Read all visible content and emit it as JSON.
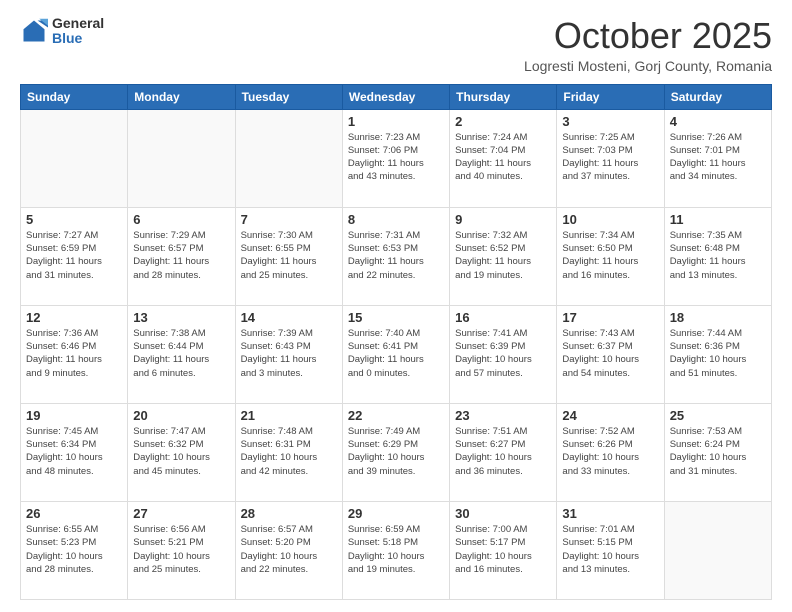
{
  "logo": {
    "general": "General",
    "blue": "Blue"
  },
  "header": {
    "month": "October 2025",
    "location": "Logresti Mosteni, Gorj County, Romania"
  },
  "days_of_week": [
    "Sunday",
    "Monday",
    "Tuesday",
    "Wednesday",
    "Thursday",
    "Friday",
    "Saturday"
  ],
  "weeks": [
    [
      {
        "day": "",
        "info": ""
      },
      {
        "day": "",
        "info": ""
      },
      {
        "day": "",
        "info": ""
      },
      {
        "day": "1",
        "info": "Sunrise: 7:23 AM\nSunset: 7:06 PM\nDaylight: 11 hours\nand 43 minutes."
      },
      {
        "day": "2",
        "info": "Sunrise: 7:24 AM\nSunset: 7:04 PM\nDaylight: 11 hours\nand 40 minutes."
      },
      {
        "day": "3",
        "info": "Sunrise: 7:25 AM\nSunset: 7:03 PM\nDaylight: 11 hours\nand 37 minutes."
      },
      {
        "day": "4",
        "info": "Sunrise: 7:26 AM\nSunset: 7:01 PM\nDaylight: 11 hours\nand 34 minutes."
      }
    ],
    [
      {
        "day": "5",
        "info": "Sunrise: 7:27 AM\nSunset: 6:59 PM\nDaylight: 11 hours\nand 31 minutes."
      },
      {
        "day": "6",
        "info": "Sunrise: 7:29 AM\nSunset: 6:57 PM\nDaylight: 11 hours\nand 28 minutes."
      },
      {
        "day": "7",
        "info": "Sunrise: 7:30 AM\nSunset: 6:55 PM\nDaylight: 11 hours\nand 25 minutes."
      },
      {
        "day": "8",
        "info": "Sunrise: 7:31 AM\nSunset: 6:53 PM\nDaylight: 11 hours\nand 22 minutes."
      },
      {
        "day": "9",
        "info": "Sunrise: 7:32 AM\nSunset: 6:52 PM\nDaylight: 11 hours\nand 19 minutes."
      },
      {
        "day": "10",
        "info": "Sunrise: 7:34 AM\nSunset: 6:50 PM\nDaylight: 11 hours\nand 16 minutes."
      },
      {
        "day": "11",
        "info": "Sunrise: 7:35 AM\nSunset: 6:48 PM\nDaylight: 11 hours\nand 13 minutes."
      }
    ],
    [
      {
        "day": "12",
        "info": "Sunrise: 7:36 AM\nSunset: 6:46 PM\nDaylight: 11 hours\nand 9 minutes."
      },
      {
        "day": "13",
        "info": "Sunrise: 7:38 AM\nSunset: 6:44 PM\nDaylight: 11 hours\nand 6 minutes."
      },
      {
        "day": "14",
        "info": "Sunrise: 7:39 AM\nSunset: 6:43 PM\nDaylight: 11 hours\nand 3 minutes."
      },
      {
        "day": "15",
        "info": "Sunrise: 7:40 AM\nSunset: 6:41 PM\nDaylight: 11 hours\nand 0 minutes."
      },
      {
        "day": "16",
        "info": "Sunrise: 7:41 AM\nSunset: 6:39 PM\nDaylight: 10 hours\nand 57 minutes."
      },
      {
        "day": "17",
        "info": "Sunrise: 7:43 AM\nSunset: 6:37 PM\nDaylight: 10 hours\nand 54 minutes."
      },
      {
        "day": "18",
        "info": "Sunrise: 7:44 AM\nSunset: 6:36 PM\nDaylight: 10 hours\nand 51 minutes."
      }
    ],
    [
      {
        "day": "19",
        "info": "Sunrise: 7:45 AM\nSunset: 6:34 PM\nDaylight: 10 hours\nand 48 minutes."
      },
      {
        "day": "20",
        "info": "Sunrise: 7:47 AM\nSunset: 6:32 PM\nDaylight: 10 hours\nand 45 minutes."
      },
      {
        "day": "21",
        "info": "Sunrise: 7:48 AM\nSunset: 6:31 PM\nDaylight: 10 hours\nand 42 minutes."
      },
      {
        "day": "22",
        "info": "Sunrise: 7:49 AM\nSunset: 6:29 PM\nDaylight: 10 hours\nand 39 minutes."
      },
      {
        "day": "23",
        "info": "Sunrise: 7:51 AM\nSunset: 6:27 PM\nDaylight: 10 hours\nand 36 minutes."
      },
      {
        "day": "24",
        "info": "Sunrise: 7:52 AM\nSunset: 6:26 PM\nDaylight: 10 hours\nand 33 minutes."
      },
      {
        "day": "25",
        "info": "Sunrise: 7:53 AM\nSunset: 6:24 PM\nDaylight: 10 hours\nand 31 minutes."
      }
    ],
    [
      {
        "day": "26",
        "info": "Sunrise: 6:55 AM\nSunset: 5:23 PM\nDaylight: 10 hours\nand 28 minutes."
      },
      {
        "day": "27",
        "info": "Sunrise: 6:56 AM\nSunset: 5:21 PM\nDaylight: 10 hours\nand 25 minutes."
      },
      {
        "day": "28",
        "info": "Sunrise: 6:57 AM\nSunset: 5:20 PM\nDaylight: 10 hours\nand 22 minutes."
      },
      {
        "day": "29",
        "info": "Sunrise: 6:59 AM\nSunset: 5:18 PM\nDaylight: 10 hours\nand 19 minutes."
      },
      {
        "day": "30",
        "info": "Sunrise: 7:00 AM\nSunset: 5:17 PM\nDaylight: 10 hours\nand 16 minutes."
      },
      {
        "day": "31",
        "info": "Sunrise: 7:01 AM\nSunset: 5:15 PM\nDaylight: 10 hours\nand 13 minutes."
      },
      {
        "day": "",
        "info": ""
      }
    ]
  ]
}
